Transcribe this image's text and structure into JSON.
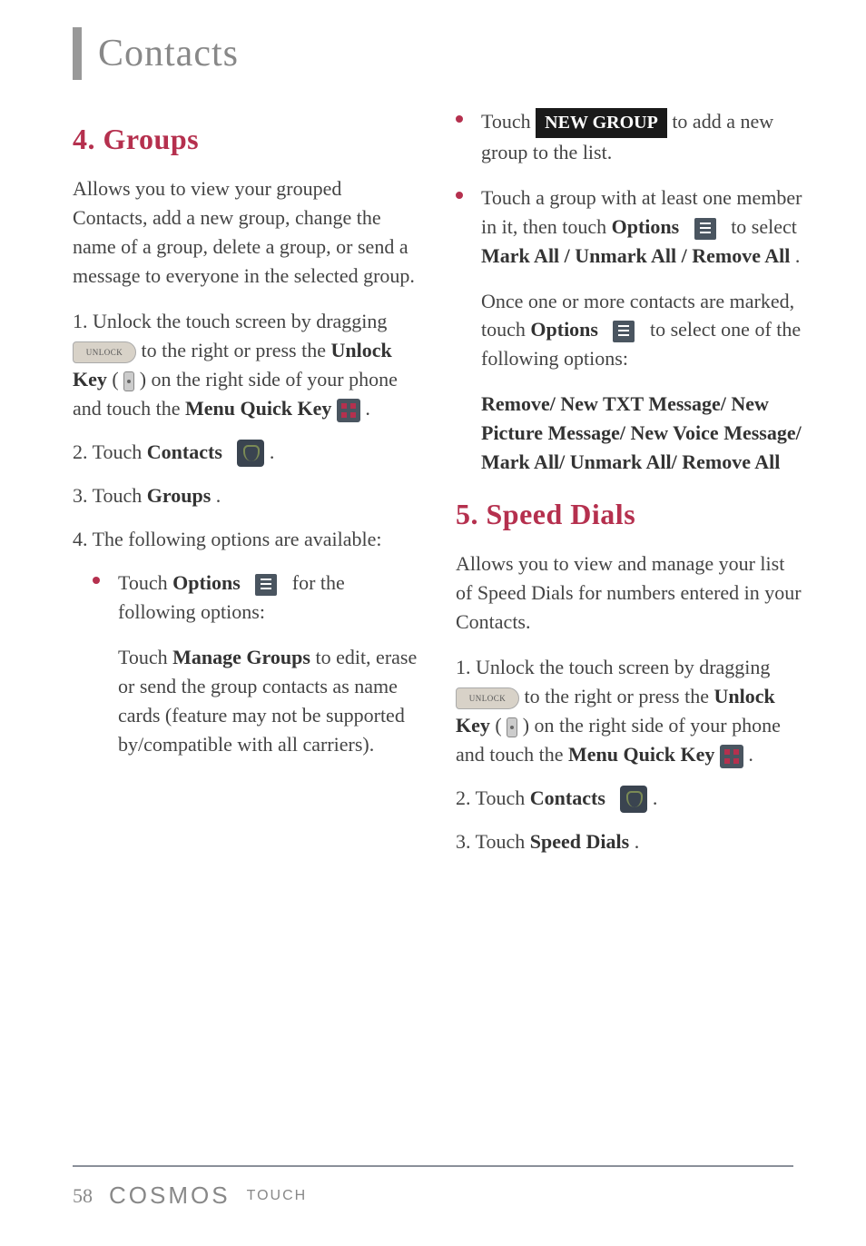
{
  "header": {
    "title": "Contacts"
  },
  "left": {
    "h1": "4. Groups",
    "intro": "Allows you to view your grouped Contacts, add a new group, change the name of a group, delete a group, or send a message to everyone in the selected group.",
    "step1_a": "1. Unlock the touch screen by dragging ",
    "step1_b": " to the right or press the ",
    "step1_unlock_key": "Unlock Key",
    "step1_c": " ( ",
    "step1_d": " ) on the right side of your phone and touch the ",
    "step1_menu": "Menu Quick Key",
    "step1_e": " .",
    "step2_a": "2. Touch ",
    "step2_contacts": "Contacts",
    "step2_b": " .",
    "step3_a": "3. Touch ",
    "step3_groups": "Groups",
    "step3_b": ".",
    "step4": "4. The following options are available:",
    "b1_a": "Touch ",
    "b1_options": "Options",
    "b1_b": " for the following options:",
    "sub1_a": "Touch ",
    "sub1_manage": "Manage Groups",
    "sub1_b": " to edit, erase or send the group contacts as name cards (feature may not be supported by/compatible with all carriers)."
  },
  "right": {
    "b2_a": "Touch ",
    "b2_newgroup": "NEW GROUP",
    "b2_b": " to add a new group to the list.",
    "b3_a": "Touch a group with at least one member in it, then touch ",
    "b3_options": "Options",
    "b3_b": " to select ",
    "b3_mark": "Mark All / Unmark All / Remove All",
    "b3_c": ".",
    "sub2_a": "Once one or more contacts are marked, touch ",
    "sub2_options": "Options",
    "sub2_b": " to select one of the following options:",
    "sub3": "Remove/ New TXT Message/ New Picture Message/ New Voice Message/ Mark All/ Unmark All/ Remove All",
    "h2": "5. Speed Dials",
    "intro2": "Allows you to view and manage your list of Speed Dials for numbers entered in your Contacts.",
    "s1_a": "1. Unlock the touch screen by dragging ",
    "s1_b": " to the right or press the ",
    "s1_unlock_key": "Unlock Key",
    "s1_c": " ( ",
    "s1_d": " ) on the right side of your phone and touch the ",
    "s1_menu": "Menu Quick Key",
    "s1_e": " .",
    "s2_a": "2. Touch ",
    "s2_contacts": "Contacts",
    "s2_b": " .",
    "s3_a": "3. Touch ",
    "s3_speed": "Speed Dials",
    "s3_b": "."
  },
  "footer": {
    "page": "58",
    "brand": "COSMOS",
    "brand_sub": "TOUCH"
  },
  "icons": {
    "unlock": "UNLOCK"
  }
}
